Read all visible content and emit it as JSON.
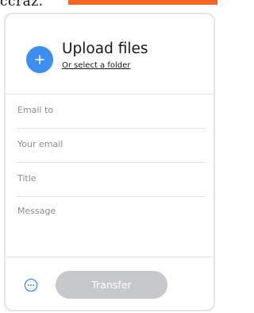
{
  "page": {
    "top_text": "ccraz.",
    "accent_color": "#f26522"
  },
  "upload": {
    "icon": "plus-icon",
    "icon_color": "#3d8ef0",
    "title": "Upload files",
    "link": "Or select a folder"
  },
  "form": {
    "email_to_placeholder": "Email to",
    "your_email_placeholder": "Your email",
    "title_placeholder": "Title",
    "message_placeholder": "Message"
  },
  "footer": {
    "more_icon": "more-options-icon",
    "transfer_label": "Transfer",
    "transfer_color": "#c6c8cc"
  }
}
